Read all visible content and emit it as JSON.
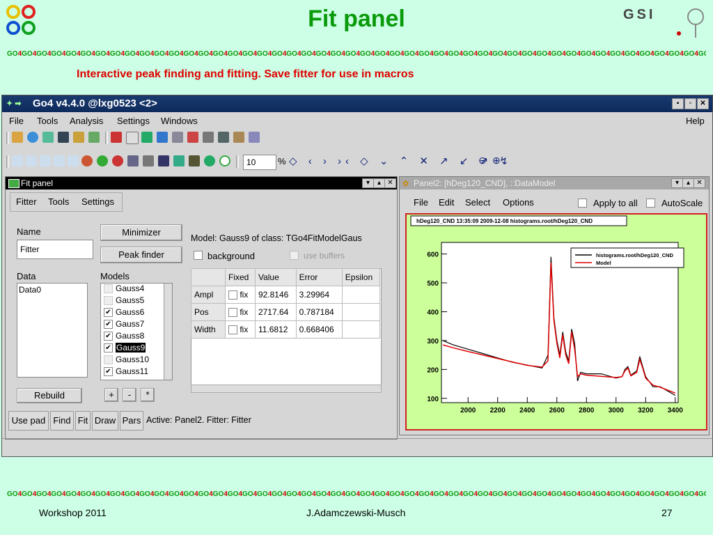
{
  "slide": {
    "title": "Fit panel",
    "subtitle": "Interactive peak finding and fitting. Save fitter for use in macros",
    "stripe_token": "GO4",
    "footer_left": "Workshop 2011",
    "footer_center": "J.Adamczewski-Musch",
    "footer_right": "27",
    "logo_right": "GSI"
  },
  "window": {
    "title": "Go4 v4.4.0 @lxg0523 <2>",
    "menu": [
      "File",
      "Tools",
      "Analysis",
      "Settings",
      "Windows"
    ],
    "help": "Help",
    "zoom_value": "10",
    "zoom_unit": "%"
  },
  "fitpanel": {
    "title": "Fit panel",
    "menu": [
      "Fitter",
      "Tools",
      "Settings"
    ],
    "name_label": "Name",
    "name_value": "Fitter",
    "minimizer_label": "Minimizer",
    "peakfinder_label": "Peak finder",
    "data_label": "Data",
    "data_items": [
      "Data0"
    ],
    "models_label": "Models",
    "models": [
      {
        "name": "Gauss4",
        "checked": false
      },
      {
        "name": "Gauss5",
        "checked": false
      },
      {
        "name": "Gauss6",
        "checked": true
      },
      {
        "name": "Gauss7",
        "checked": true
      },
      {
        "name": "Gauss8",
        "checked": true
      },
      {
        "name": "Gauss9",
        "checked": true
      },
      {
        "name": "Gauss10",
        "checked": false
      },
      {
        "name": "Gauss11",
        "checked": true
      }
    ],
    "model_info": "Model: Gauss9   of class: TGo4FitModelGaus",
    "background_label": "background",
    "use_buffers_label": "use buffers",
    "table_headers": [
      "Fixed",
      "Value",
      "Error",
      "Epsilon"
    ],
    "fix_label": "fix",
    "rows": [
      {
        "name": "Ampl",
        "value": "92.8146",
        "error": "3.29964"
      },
      {
        "name": "Pos",
        "value": "2717.64",
        "error": "0.787184"
      },
      {
        "name": "Width",
        "value": "11.6812",
        "error": "0.668406"
      }
    ],
    "rebuild_label": "Rebuild",
    "plus": "+",
    "minus": "-",
    "star": "*",
    "bottom_tabs": [
      "Use pad",
      "Find",
      "Fit",
      "Draw",
      "Pars"
    ],
    "status": "Active: Panel2. Fitter: Fitter"
  },
  "panel2": {
    "title": "Panel2: [hDeg120_CND], ::DataModel",
    "menu": [
      "File",
      "Edit",
      "Select",
      "Options"
    ],
    "apply_all": "Apply to all",
    "autoscale": "AutoScale",
    "stats": "hDeg120_CND  13:35:09  2009-12-08  histograms.root/hDeg120_CND",
    "legend": [
      "histograms.root/hDeg120_CND",
      "Model"
    ]
  },
  "chart_data": {
    "type": "line",
    "title": "hDeg120_CND  13:35:09  2009-12-08  histograms.root/hDeg120_CND",
    "xlim": [
      1820,
      3420
    ],
    "ylim": [
      85,
      640
    ],
    "xticks": [
      2000,
      2200,
      2400,
      2600,
      2800,
      3000,
      3200,
      3400
    ],
    "yticks": [
      100,
      200,
      300,
      400,
      500,
      600
    ],
    "series": [
      {
        "name": "histograms.root/hDeg120_CND",
        "color": "#000000",
        "x": [
          1830,
          1900,
          2000,
          2100,
          2200,
          2300,
          2400,
          2500,
          2540,
          2560,
          2580,
          2600,
          2620,
          2640,
          2660,
          2680,
          2700,
          2720,
          2740,
          2760,
          2800,
          2900,
          3000,
          3040,
          3060,
          3080,
          3100,
          3140,
          3160,
          3180,
          3200,
          3250,
          3300,
          3400
        ],
        "y": [
          300,
          285,
          270,
          255,
          240,
          225,
          215,
          205,
          250,
          590,
          380,
          300,
          250,
          330,
          260,
          230,
          340,
          290,
          160,
          190,
          185,
          185,
          170,
          175,
          200,
          210,
          180,
          195,
          245,
          210,
          175,
          140,
          140,
          110
        ]
      },
      {
        "name": "Model",
        "color": "#e00000",
        "x": [
          1830,
          1900,
          2000,
          2100,
          2200,
          2300,
          2400,
          2500,
          2540,
          2560,
          2580,
          2600,
          2620,
          2640,
          2660,
          2680,
          2700,
          2720,
          2740,
          2760,
          2800,
          2900,
          3000,
          3040,
          3060,
          3080,
          3100,
          3140,
          3160,
          3180,
          3200,
          3250,
          3300,
          3400
        ],
        "y": [
          285,
          275,
          262,
          250,
          238,
          226,
          214,
          208,
          230,
          570,
          370,
          290,
          240,
          320,
          250,
          220,
          330,
          270,
          175,
          185,
          180,
          176,
          172,
          175,
          195,
          205,
          178,
          190,
          235,
          205,
          170,
          145,
          138,
          118
        ]
      }
    ]
  }
}
